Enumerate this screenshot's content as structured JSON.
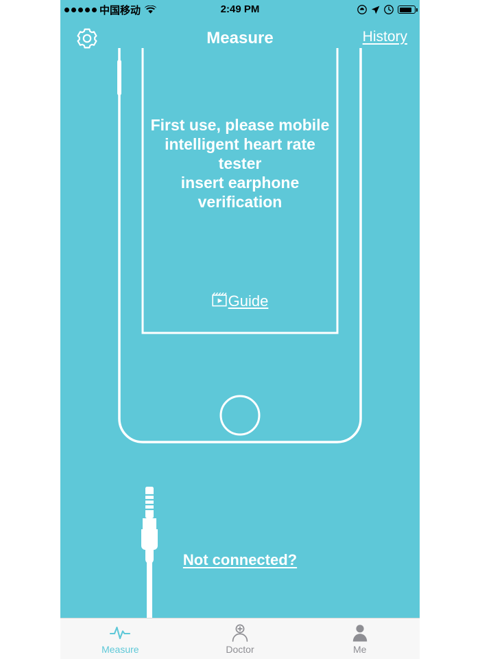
{
  "theme": {
    "accent": "#5ec8d8",
    "white": "#ffffff",
    "tabbar_bg": "#f7f7f7",
    "tab_inactive": "#8e8e93",
    "tab_active": "#5ec8d8",
    "status_text": "#000000"
  },
  "status_bar": {
    "signal_dots": 5,
    "carrier": "中国移动",
    "wifi_icon": "wifi-icon",
    "time": "2:49 PM",
    "right_icons": [
      "do-not-disturb-icon",
      "location-arrow-icon",
      "alarm-clock-icon"
    ],
    "battery_icon": "battery-icon",
    "battery_level_percent": 78
  },
  "nav_bar": {
    "settings_icon": "gear-icon",
    "title": "Measure",
    "history_label": "History"
  },
  "main": {
    "instruction_lines": [
      "First use, please mobile",
      "intelligent heart rate",
      "tester",
      "insert earphone",
      "verification"
    ],
    "guide": {
      "icon": "video-guide-icon",
      "label": "Guide"
    },
    "jack_icon": "earphone-jack-icon",
    "not_connected_label": "Not connected?"
  },
  "tab_bar": {
    "items": [
      {
        "label": "Measure",
        "icon": "heartbeat-pulse-icon",
        "active": true
      },
      {
        "label": "Doctor",
        "icon": "doctor-plus-icon",
        "active": false
      },
      {
        "label": "Me",
        "icon": "person-icon",
        "active": false
      }
    ]
  }
}
